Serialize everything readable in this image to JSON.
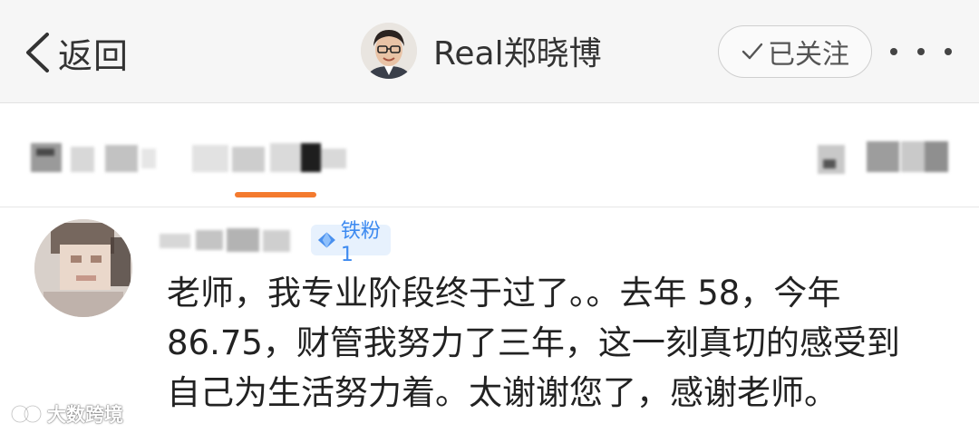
{
  "header": {
    "back_label": "返回",
    "profile_name": "Real郑晓博",
    "follow_label": "已关注"
  },
  "comment": {
    "badge_label": "铁粉1",
    "lines": [
      "老师，我专业阶段终于过了。。去年 58，今年",
      "86.75，财管我努力了三年，这一刻真切的感受到",
      "自己为生活努力着。太谢谢您了，感谢老师。"
    ]
  },
  "watermark": {
    "text": "大数跨境"
  },
  "colors": {
    "accent_orange": "#f47a2e",
    "badge_blue": "#3d8af0",
    "badge_bg": "#e7f1fd",
    "navbar_bg": "#f6f6f6"
  },
  "icons": [
    "chevron-left-icon",
    "checkmark-icon",
    "more-dots-icon",
    "diamond-icon",
    "watermark-logo-icon"
  ]
}
